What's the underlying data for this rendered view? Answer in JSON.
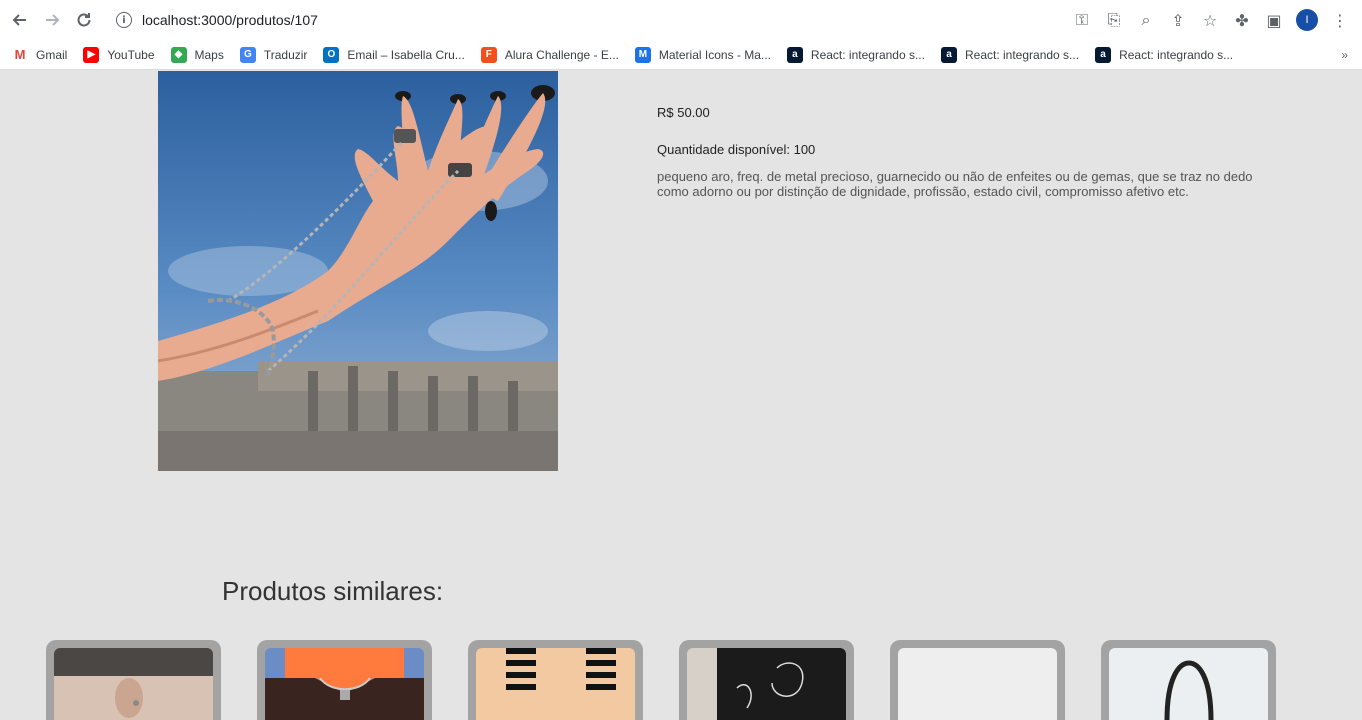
{
  "browser": {
    "url": "localhost:3000/produtos/107",
    "avatar_letter": "I",
    "bookmarks": [
      {
        "label": "Gmail",
        "icon": "gmail-icon",
        "color": "#ea4335"
      },
      {
        "label": "YouTube",
        "icon": "youtube-icon",
        "color": "#ff0000"
      },
      {
        "label": "Maps",
        "icon": "maps-icon",
        "color": "#34a853"
      },
      {
        "label": "Traduzir",
        "icon": "translate-icon",
        "color": "#4285f4"
      },
      {
        "label": "Email – Isabella Cru...",
        "icon": "outlook-icon",
        "color": "#0072c6"
      },
      {
        "label": "Alura Challenge - E...",
        "icon": "figma-icon",
        "color": "#f24e1e"
      },
      {
        "label": "Material Icons - Ma...",
        "icon": "material-icon",
        "color": "#1a73e8"
      },
      {
        "label": "React: integrando s...",
        "icon": "alura-icon",
        "color": "#051933"
      },
      {
        "label": "React: integrando s...",
        "icon": "alura-icon",
        "color": "#051933"
      },
      {
        "label": "React: integrando s...",
        "icon": "alura-icon",
        "color": "#051933"
      }
    ]
  },
  "product": {
    "price": "R$ 50.00",
    "quantity": "Quantidade disponível: 100",
    "description": "pequeno aro, freq. de metal precioso, guarnecido ou não de enfeites ou de gemas, que se traz no dedo como adorno ou por distinção de dignidade, profissão, estado civil, compromisso afetivo etc."
  },
  "similar": {
    "title": "Produtos similares:",
    "cards": [
      {
        "name": "similar-card-1"
      },
      {
        "name": "similar-card-2"
      },
      {
        "name": "similar-card-3"
      },
      {
        "name": "similar-card-4"
      },
      {
        "name": "similar-card-5"
      },
      {
        "name": "similar-card-6"
      }
    ]
  }
}
